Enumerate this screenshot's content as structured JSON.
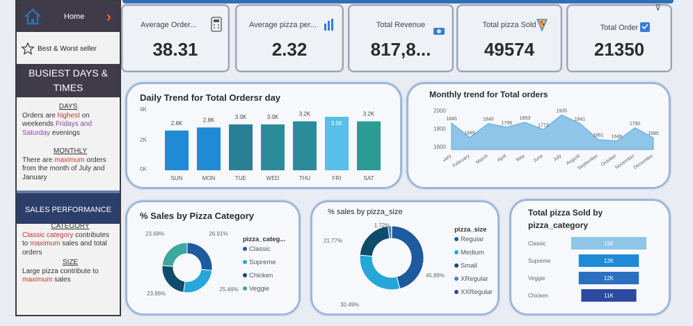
{
  "sidebar": {
    "home_label": "Home",
    "best_worst_label": "Best & Worst seller",
    "busiest_title_line1": "BUSIEST DAYS &",
    "busiest_title_line2": "TIMES",
    "days_heading": "DAYS",
    "days_text_1": "Orders are ",
    "days_text_hl1": "highest",
    "days_text_2": " on",
    "days_text_3": "weekends ",
    "days_text_hl2": "Fridays and",
    "days_text_hl3": "Saturday",
    "days_text_4": " evenings",
    "monthly_heading": "MONTHLY",
    "monthly_text_1": "There are ",
    "monthly_text_hl": "maximum",
    "monthly_text_2": " orders",
    "monthly_text_3": "from the month of July and",
    "monthly_text_4": "January",
    "sales_perf_title": "SALES PERFORMANCE",
    "category_heading": "CATEGORY",
    "category_text_hl": "Classic category",
    "category_text_1": " contributes",
    "category_text_2": "to ",
    "category_text_hl2": "maximum",
    "category_text_3": " sales and total",
    "category_text_4": "orders",
    "size_heading": "SIZE",
    "size_text_1": "Large pizza contribute to",
    "size_text_hl": "maximum",
    "size_text_2": " sales"
  },
  "kpis": [
    {
      "label": "Average Order...",
      "value": "38.31"
    },
    {
      "label": "Average pizza per...",
      "value": "2.32"
    },
    {
      "label": "Total Revenue",
      "value": "817,8..."
    },
    {
      "label": "Total pizza Sold",
      "value": "49574"
    },
    {
      "label": "Total Order",
      "value": "21350"
    }
  ],
  "colors": {
    "dark_panel": "#3f3b49",
    "navy": "#2c3e6a",
    "bar_blue": "#1f8ad6",
    "bar_teal": "#2a8c9a",
    "highlight": "#c0392b",
    "area": "#8ec5e8"
  },
  "chart_data": [
    {
      "type": "bar",
      "title": "Daily Trend for Total Ordersr day",
      "categories": [
        "SUN",
        "MON",
        "TUE",
        "WED",
        "THU",
        "FRI",
        "SAT"
      ],
      "values": [
        2600,
        2800,
        3000,
        3000,
        3200,
        3500,
        3200
      ],
      "data_labels": [
        "2.6K",
        "2.8K",
        "3.0K",
        "3.0K",
        "3.2K",
        "3.5K",
        "3.2K"
      ],
      "yticks": [
        "4K",
        "2K",
        "0K"
      ],
      "ylim": [
        0,
        4000
      ]
    },
    {
      "type": "area",
      "title": "Monthly trend for Total orders",
      "categories": [
        "January",
        "February",
        "March",
        "April",
        "May",
        "June",
        "July",
        "August",
        "September",
        "October",
        "November",
        "December"
      ],
      "values": [
        1845,
        1685,
        1840,
        1799,
        1853,
        1773,
        1935,
        1841,
        1661,
        1646,
        1792,
        1680
      ],
      "data_labels": [
        "1845",
        "1685",
        "1840",
        "1799",
        "1853",
        "1773",
        "1935",
        "1841",
        "1661",
        "1646",
        "1792",
        "1680"
      ],
      "yticks": [
        "2000",
        "1800",
        "1600"
      ],
      "ylim": [
        1550,
        2000
      ]
    },
    {
      "type": "pie",
      "title": "% Sales by Pizza Category",
      "legend_title": "pizza_categ...",
      "labels": [
        "Classic",
        "Supreme",
        "Chicken",
        "Veggie"
      ],
      "values": [
        26.91,
        25.46,
        23.96,
        23.68
      ],
      "data_labels": [
        "26.91%",
        "25.46%",
        "23.96%",
        "23.68%"
      ],
      "colors": [
        "#1e5a9e",
        "#27a6d9",
        "#0f4c6b",
        "#3fa6a0"
      ]
    },
    {
      "type": "pie",
      "title": "% sales by pizza_size",
      "legend_title": "pizza_size",
      "labels": [
        "Regular",
        "Medium",
        "Small",
        "XRegular",
        "XXRegular"
      ],
      "values": [
        45.89,
        30.49,
        21.77,
        1.72,
        0.12
      ],
      "data_labels": [
        "45.89%",
        "30.49%",
        "21.77%",
        "1.72%"
      ],
      "colors": [
        "#1e5a9e",
        "#27a6d9",
        "#0f4c6b",
        "#4a7fc4",
        "#2e4a8c"
      ]
    },
    {
      "type": "bar",
      "orientation": "horizontal",
      "title_line1": "Total pizza Sold by",
      "title_line2": "pizza_category",
      "categories": [
        "Classic",
        "Supreme",
        "Veggie",
        "Chicken"
      ],
      "values": [
        15000,
        12000,
        12000,
        11000
      ],
      "data_labels": [
        "15K",
        "12K",
        "12K",
        "11K"
      ],
      "colors": [
        "#8ec5e8",
        "#1f8ad6",
        "#2a6fc0",
        "#2b4aa0"
      ],
      "xlim": [
        0,
        15000
      ]
    }
  ]
}
